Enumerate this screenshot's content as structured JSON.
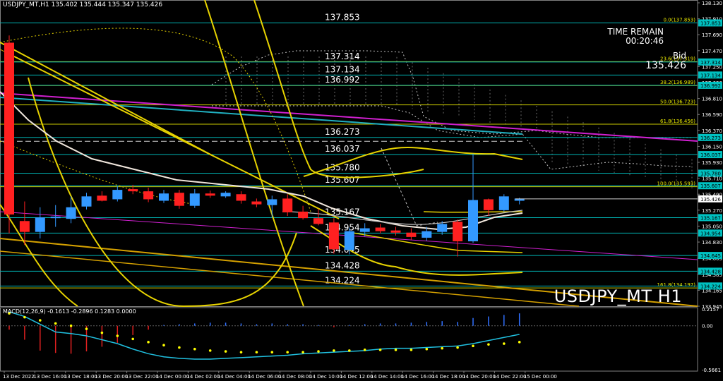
{
  "window": {
    "symbol_info": "USDJPY_MT,H1  135.402 135.444 135.347 135.426",
    "time_remain_label": "TIME REMAIN",
    "time_remain_value": "00:20:46",
    "bid_label": "Bid",
    "bid_value": "135.426",
    "big_symbol": "USDJPY_MT H1",
    "macd_label": "MACD(12,26,9) -0.1613 -0.2896 0.1283 0.0000"
  },
  "colors": {
    "background": "#000000",
    "bull": "#3399ff",
    "bear": "#ff2020",
    "level_line": "#00b3b3",
    "fib_line": "#c8c800",
    "axis_text": "#ffffff",
    "price_tag_bg": "#00c0c0",
    "bid_tag_bg": "#ffffff",
    "envelope": "#e6d200",
    "ma_white": "#f0e6dc",
    "trend_magenta": "#d020d0",
    "trend_orange": "#d4a000",
    "ichimoku": "#c0c0c0",
    "macd_signal_line": "#20c0e0",
    "macd_dots": "#ffff00"
  },
  "chart_data": {
    "type": "candlestick",
    "symbol": "USDJPY_MT",
    "timeframe": "H1",
    "ylim": [
      133.945,
      138.13
    ],
    "y_ticks": [
      "138.130",
      "137.910",
      "137.690",
      "137.470",
      "137.250",
      "137.030",
      "136.810",
      "136.590",
      "136.370",
      "136.150",
      "135.930",
      "135.710",
      "135.490",
      "135.270",
      "135.050",
      "134.830",
      "134.605",
      "134.385",
      "134.165",
      "133.945"
    ],
    "x_labels": [
      "13 Dec 2022",
      "13 Dec 16:00",
      "13 Dec 18:00",
      "13 Dec 20:00",
      "13 Dec 22:00",
      "14 Dec 00:00",
      "14 Dec 02:00",
      "14 Dec 04:00",
      "14 Dec 06:00",
      "14 Dec 08:00",
      "14 Dec 10:00",
      "14 Dec 12:00",
      "14 Dec 14:00",
      "14 Dec 16:00",
      "14 Dec 18:00",
      "14 Dec 20:00",
      "14 Dec 22:00",
      "15 Dec 00:00"
    ],
    "candles": [
      {
        "o": 137.58,
        "h": 137.68,
        "l": 134.95,
        "c": 135.21
      },
      {
        "o": 135.12,
        "h": 135.39,
        "l": 134.79,
        "c": 134.97
      },
      {
        "o": 134.97,
        "h": 135.31,
        "l": 134.88,
        "c": 135.17
      },
      {
        "o": 135.16,
        "h": 135.34,
        "l": 135.04,
        "c": 135.18
      },
      {
        "o": 135.15,
        "h": 135.46,
        "l": 135.09,
        "c": 135.31
      },
      {
        "o": 135.32,
        "h": 135.51,
        "l": 135.28,
        "c": 135.46
      },
      {
        "o": 135.47,
        "h": 135.53,
        "l": 135.39,
        "c": 135.4
      },
      {
        "o": 135.42,
        "h": 135.6,
        "l": 135.39,
        "c": 135.55
      },
      {
        "o": 135.56,
        "h": 135.62,
        "l": 135.49,
        "c": 135.53
      },
      {
        "o": 135.53,
        "h": 135.58,
        "l": 135.38,
        "c": 135.42
      },
      {
        "o": 135.4,
        "h": 135.55,
        "l": 135.37,
        "c": 135.5
      },
      {
        "o": 135.51,
        "h": 135.55,
        "l": 135.29,
        "c": 135.33
      },
      {
        "o": 135.33,
        "h": 135.56,
        "l": 135.3,
        "c": 135.5
      },
      {
        "o": 135.5,
        "h": 135.54,
        "l": 135.44,
        "c": 135.47
      },
      {
        "o": 135.46,
        "h": 135.53,
        "l": 135.44,
        "c": 135.51
      },
      {
        "o": 135.49,
        "h": 135.53,
        "l": 135.36,
        "c": 135.4
      },
      {
        "o": 135.39,
        "h": 135.43,
        "l": 135.31,
        "c": 135.35
      },
      {
        "o": 135.34,
        "h": 135.47,
        "l": 135.17,
        "c": 135.42
      },
      {
        "o": 135.43,
        "h": 135.49,
        "l": 135.19,
        "c": 135.24
      },
      {
        "o": 135.25,
        "h": 135.33,
        "l": 135.14,
        "c": 135.16
      },
      {
        "o": 135.16,
        "h": 135.29,
        "l": 135.06,
        "c": 135.08
      },
      {
        "o": 135.1,
        "h": 135.16,
        "l": 134.67,
        "c": 134.73
      },
      {
        "o": 134.72,
        "h": 135.03,
        "l": 134.66,
        "c": 134.98
      },
      {
        "o": 134.97,
        "h": 135.09,
        "l": 134.91,
        "c": 135.02
      },
      {
        "o": 135.03,
        "h": 135.08,
        "l": 134.95,
        "c": 134.98
      },
      {
        "o": 134.99,
        "h": 135.04,
        "l": 134.92,
        "c": 134.96
      },
      {
        "o": 134.96,
        "h": 135.02,
        "l": 134.86,
        "c": 134.9
      },
      {
        "o": 134.89,
        "h": 135.04,
        "l": 134.85,
        "c": 134.98
      },
      {
        "o": 134.97,
        "h": 135.12,
        "l": 134.93,
        "c": 135.08
      },
      {
        "o": 135.11,
        "h": 135.14,
        "l": 134.63,
        "c": 134.84
      },
      {
        "o": 134.84,
        "h": 136.05,
        "l": 134.82,
        "c": 135.41
      },
      {
        "o": 135.42,
        "h": 135.43,
        "l": 135.19,
        "c": 135.27
      },
      {
        "o": 135.27,
        "h": 135.49,
        "l": 135.25,
        "c": 135.46
      },
      {
        "o": 135.4,
        "h": 135.44,
        "l": 135.35,
        "c": 135.43
      }
    ],
    "horizontal_levels": [
      {
        "label": "137.853",
        "value": 137.853,
        "kind": "level"
      },
      {
        "label": "137.314",
        "value": 137.314,
        "kind": "level"
      },
      {
        "label": "137.134",
        "value": 137.134,
        "kind": "level"
      },
      {
        "label": "136.992",
        "value": 136.992,
        "kind": "level"
      },
      {
        "label": "136.273",
        "value": 136.273,
        "kind": "level"
      },
      {
        "label": "136.037",
        "value": 136.037,
        "kind": "level"
      },
      {
        "label": "135.780",
        "value": 135.78,
        "kind": "level"
      },
      {
        "label": "135.607",
        "value": 135.607,
        "kind": "level"
      },
      {
        "label": "135.167",
        "value": 135.167,
        "kind": "level"
      },
      {
        "label": "134.954",
        "value": 134.954,
        "kind": "level"
      },
      {
        "label": "134.645",
        "value": 134.645,
        "kind": "level"
      },
      {
        "label": "134.428",
        "value": 134.428,
        "kind": "level"
      },
      {
        "label": "134.224",
        "value": 134.224,
        "kind": "level"
      }
    ],
    "fib_levels": [
      {
        "label": "0.0(137.853)",
        "value": 137.853
      },
      {
        "label": "23.6(137.319)",
        "value": 137.319
      },
      {
        "label": "38.2(136.989)",
        "value": 136.989
      },
      {
        "label": "50.0(136.723)",
        "value": 136.723
      },
      {
        "label": "61.8(136.456)",
        "value": 136.456
      },
      {
        "label": "100.0(135.593)",
        "value": 135.593
      },
      {
        "label": "161.8(134.197)",
        "value": 134.197
      }
    ],
    "price_tags": [
      {
        "label": "137.853",
        "value": 137.853
      },
      {
        "label": "137.314",
        "value": 137.314
      },
      {
        "label": "137.134",
        "value": 137.134
      },
      {
        "label": "136.992",
        "value": 136.992
      },
      {
        "label": "136.273",
        "value": 136.273
      },
      {
        "label": "136.037",
        "value": 136.037
      },
      {
        "label": "135.780",
        "value": 135.78
      },
      {
        "label": "135.607",
        "value": 135.607
      },
      {
        "label": "135.167",
        "value": 135.167
      },
      {
        "label": "134.954",
        "value": 134.954
      },
      {
        "label": "134.645",
        "value": 134.645
      },
      {
        "label": "134.428",
        "value": 134.428
      },
      {
        "label": "134.224",
        "value": 134.224
      }
    ],
    "bid_tag": {
      "label": "135.426",
      "value": 135.426
    },
    "macd": {
      "ylim": [
        -0.5661,
        0.2157
      ],
      "y_ticks": [
        "0.2157",
        "0.00",
        "-0.5661"
      ],
      "histogram": [
        -0.05,
        -0.18,
        -0.32,
        -0.35,
        -0.36,
        -0.33,
        -0.27,
        -0.22,
        -0.12,
        -0.05,
        0.01,
        0.02,
        0.03,
        0.04,
        0.04,
        0.03,
        0.02,
        0.03,
        0.02,
        0.02,
        0.01,
        -0.02,
        0.01,
        0.02,
        0.03,
        0.03,
        0.04,
        0.05,
        0.06,
        0.05,
        0.1,
        0.12,
        0.14,
        0.16
      ],
      "signal": [
        0.18,
        0.12,
        0.02,
        -0.08,
        -0.1,
        -0.13,
        -0.18,
        -0.23,
        -0.3,
        -0.36,
        -0.4,
        -0.42,
        -0.43,
        -0.43,
        -0.42,
        -0.41,
        -0.4,
        -0.39,
        -0.38,
        -0.36,
        -0.35,
        -0.34,
        -0.33,
        -0.32,
        -0.3,
        -0.29,
        -0.29,
        -0.28,
        -0.27,
        -0.26,
        -0.23,
        -0.19,
        -0.15,
        -0.11
      ],
      "dots": [
        0.16,
        0.11,
        0.07,
        0.03,
        0.0,
        -0.04,
        -0.09,
        -0.13,
        -0.17,
        -0.21,
        -0.25,
        -0.28,
        -0.3,
        -0.32,
        -0.33,
        -0.34,
        -0.34,
        -0.34,
        -0.34,
        -0.34,
        -0.33,
        -0.32,
        -0.32,
        -0.31,
        -0.31,
        -0.31,
        -0.31,
        -0.3,
        -0.29,
        -0.28,
        -0.26,
        -0.24,
        -0.23,
        -0.21
      ]
    }
  }
}
